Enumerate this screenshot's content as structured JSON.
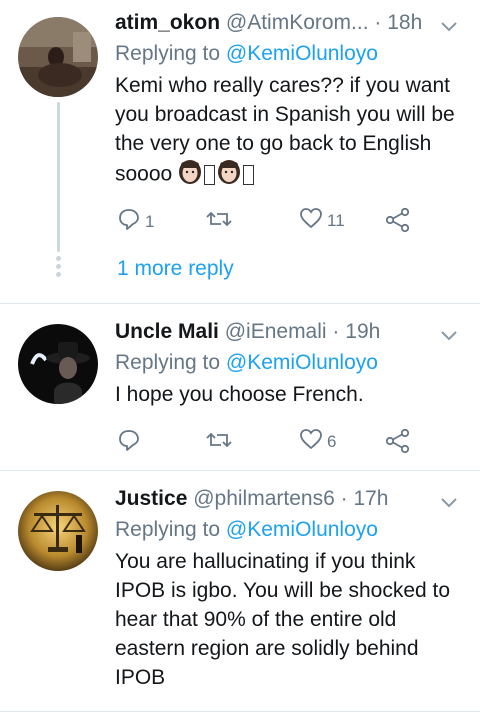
{
  "tweets": [
    {
      "name": "atim_okon",
      "handle": "@AtimKorom...",
      "separator": "·",
      "time": "18h",
      "replying_prefix": "Replying to ",
      "replying_mention": "@KemiOlunloyo",
      "text_main": "Kemi who really cares?? if you want you broadcast in Spanish you will be the very one to go back to English soooo ",
      "text_glyph": "",
      "reply_count": "1",
      "retweet_count": "",
      "like_count": "11",
      "more_reply": "1 more reply"
    },
    {
      "name": "Uncle Mali",
      "handle": "@iEnemali",
      "separator": "·",
      "time": "19h",
      "replying_prefix": "Replying to ",
      "replying_mention": "@KemiOlunloyo",
      "text": "I hope you choose French.",
      "reply_count": "",
      "retweet_count": "",
      "like_count": "6"
    },
    {
      "name": "Justice",
      "handle": "@philmartens6",
      "separator": "·",
      "time": "17h",
      "replying_prefix": "Replying to ",
      "replying_mention": "@KemiOlunloyo",
      "text": "You are hallucinating if you think IPOB is igbo. You will be shocked to hear that 90% of the  entire old eastern region are solidly behind IPOB"
    }
  ],
  "colors": {
    "accent": "#1da1f2",
    "secondary_text": "#657786",
    "divider": "#e1e8ed"
  },
  "icons": [
    "chevron-down-icon",
    "reply-icon",
    "retweet-icon",
    "like-icon",
    "share-icon",
    "woman-emoji"
  ]
}
